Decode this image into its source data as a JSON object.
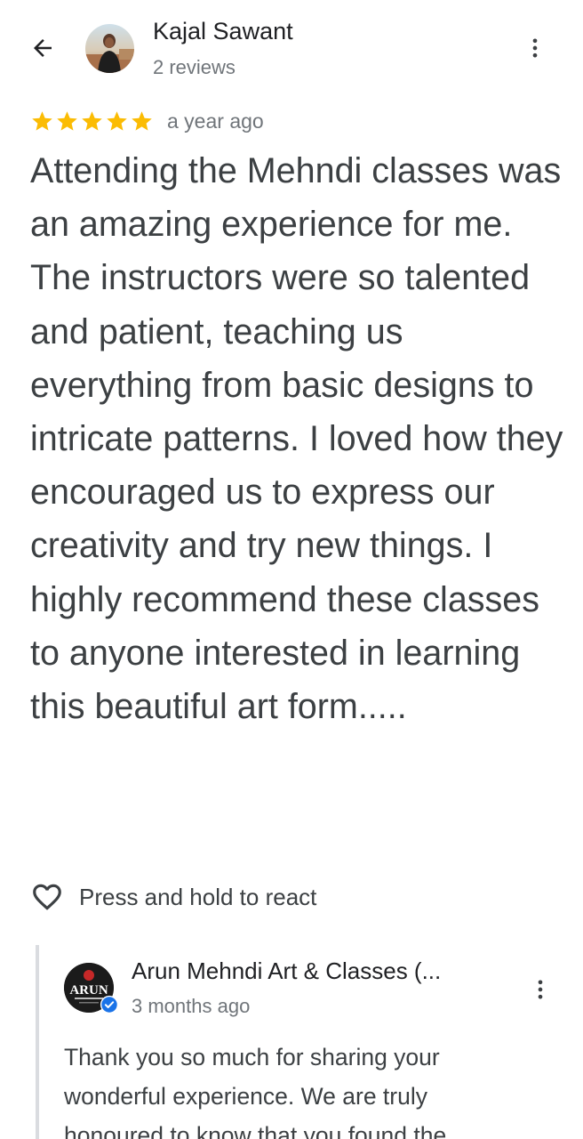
{
  "header": {
    "back_icon": "arrow-back-icon",
    "reviewer_name": "Kajal Sawant",
    "reviewer_reviews": "2 reviews",
    "more_icon": "more-vert-icon"
  },
  "review": {
    "rating": 5,
    "max_rating": 5,
    "star_color": "#fbbc04",
    "time": "a year ago",
    "text": "Attending the Mehndi classes was an amazing experience for me. The instructors were so talented and patient, teaching us everything from basic designs to intricate patterns. I loved how they encouraged us to express our creativity and try new things. I highly recommend these classes to anyone interested in learning this beautiful art form....."
  },
  "react": {
    "icon": "heart-outline-icon",
    "label": "Press and hold to react"
  },
  "owner_reply": {
    "owner_name": "Arun Mehndi Art & Classes (...",
    "logo_text": "ARUN",
    "verified_icon": "verified-badge-icon",
    "verified_color": "#1a73e8",
    "time": "3 months ago",
    "text": "Thank you so much for sharing your wonderful experience. We are truly honoured to know that you found the"
  }
}
